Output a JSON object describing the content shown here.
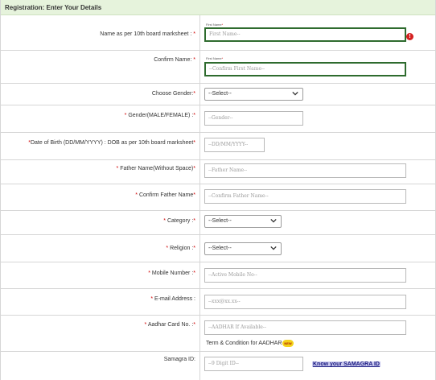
{
  "header": {
    "title": "Registration: Enter Your Details"
  },
  "fields": {
    "name": {
      "label": "Name as per 10th board marksheet :",
      "tiny": "First Name",
      "placeholder": "First Name--"
    },
    "confirm_name": {
      "label": "Confirm Name:",
      "tiny": "First Name",
      "placeholder": "--Confirm First Name--"
    },
    "choose_gender": {
      "label": "Choose Gender:",
      "selected": "--Select--"
    },
    "gender_text": {
      "label": "Gender(MALE/FEMALE) :",
      "placeholder": "--Gender--"
    },
    "dob": {
      "label": "Date of Birth (DD/MM/YYYY) : DOB as per 10th board marksheet",
      "placeholder": "--DD/MM/YYYY--"
    },
    "father_name": {
      "label": "Father Name(Without Space)",
      "placeholder": "--Father Name--"
    },
    "confirm_father": {
      "label": "Confirm Father Name",
      "placeholder": "--Confirm Father Name--"
    },
    "category": {
      "label": "Category :",
      "selected": "--Select--"
    },
    "religion": {
      "label": "Religion :",
      "selected": "--Select--"
    },
    "mobile": {
      "label": "Mobile Number :",
      "placeholder": "--Active Mobile No--"
    },
    "email": {
      "label": "E-mail Address :",
      "placeholder": "--xxx@xx.xx--"
    },
    "aadhar": {
      "label": "Aadhar Card No. :",
      "placeholder": "--AADHAR If Available--",
      "note": "Term & Condition for AADHAR",
      "badge": "NEW"
    },
    "samagra": {
      "label": "Samagra ID:",
      "placeholder": "--9 Digit ID--",
      "link": "Know your SAMAGRA ID"
    }
  },
  "required_mark": "*",
  "error_icon": "!",
  "colors": {
    "header_bg": "#e6f3dc",
    "required": "#d00000",
    "focus_border": "#2e6b2e",
    "error": "#d42020"
  }
}
